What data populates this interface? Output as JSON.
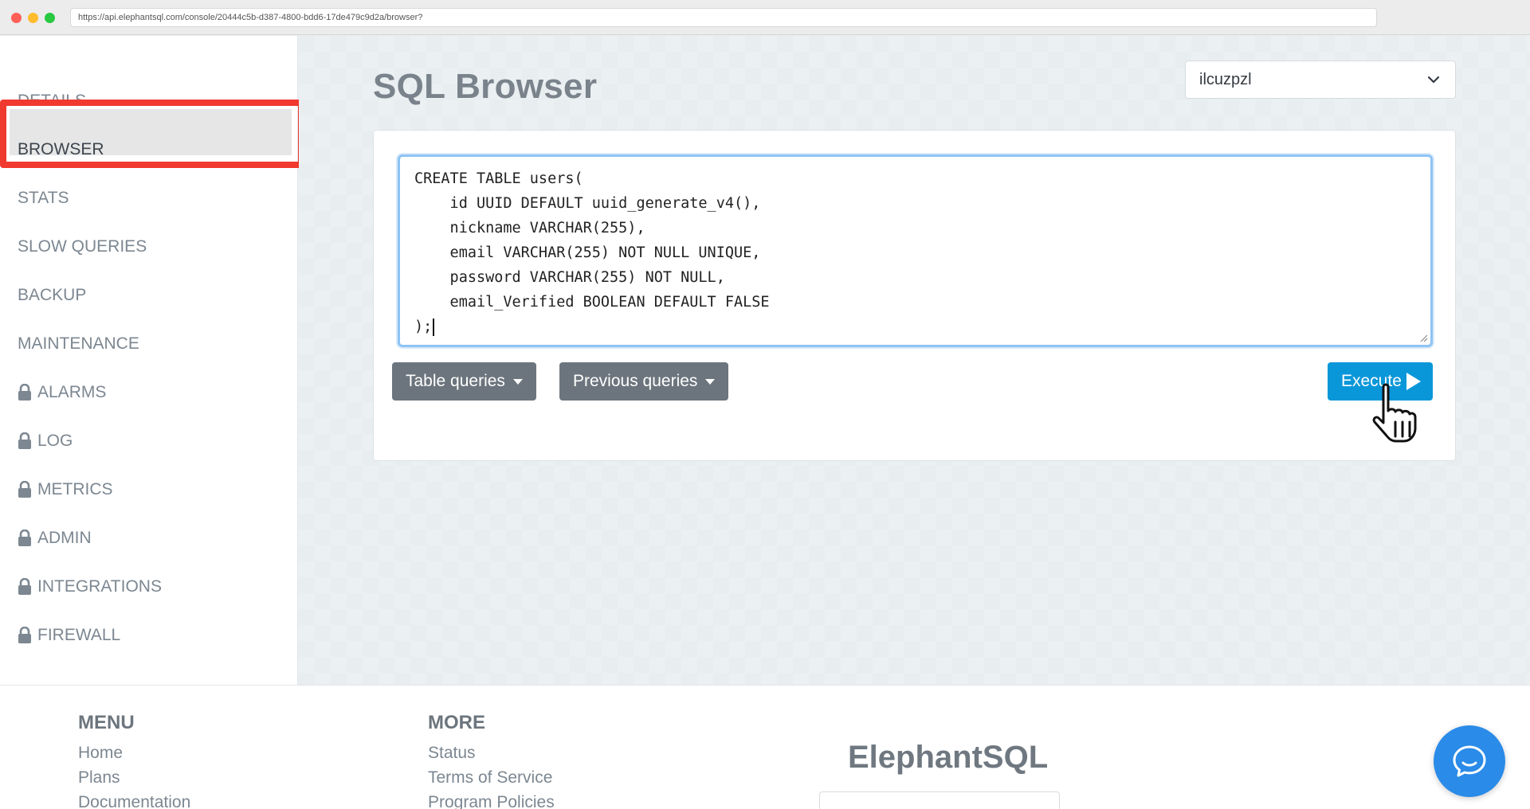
{
  "browser": {
    "url": "https://api.elephantsql.com/console/20444c5b-d387-4800-bdd6-17de479c9d2a/browser?"
  },
  "sidebar": {
    "items": [
      {
        "label": "DETAILS",
        "locked": false
      },
      {
        "label": "BROWSER",
        "locked": false,
        "active": true
      },
      {
        "label": "STATS",
        "locked": false
      },
      {
        "label": "SLOW QUERIES",
        "locked": false
      },
      {
        "label": "BACKUP",
        "locked": false
      },
      {
        "label": "MAINTENANCE",
        "locked": false
      },
      {
        "label": "ALARMS",
        "locked": true
      },
      {
        "label": "LOG",
        "locked": true
      },
      {
        "label": "METRICS",
        "locked": true
      },
      {
        "label": "ADMIN",
        "locked": true
      },
      {
        "label": "INTEGRATIONS",
        "locked": true
      },
      {
        "label": "FIREWALL",
        "locked": true
      }
    ]
  },
  "main": {
    "title": "SQL Browser",
    "database_select": {
      "value": "ilcuzpzl"
    },
    "editor": {
      "lines": [
        "CREATE TABLE users(",
        "    id UUID DEFAULT uuid_generate_v4(),",
        "    nickname VARCHAR(255),",
        "    email VARCHAR(255) NOT NULL UNIQUE,",
        "    password VARCHAR(255) NOT NULL,",
        "    email_Verified BOOLEAN DEFAULT FALSE",
        ");"
      ]
    },
    "table_queries_label": "Table queries",
    "previous_queries_label": "Previous queries",
    "execute_label": "Execute"
  },
  "footer": {
    "menu": {
      "heading": "MENU",
      "links": [
        "Home",
        "Plans",
        "Documentation"
      ]
    },
    "more": {
      "heading": "MORE",
      "links": [
        "Status",
        "Terms of Service",
        "Program Policies"
      ]
    },
    "brand": "ElephantSQL"
  },
  "colors": {
    "accent": "#0a97d9",
    "highlight": "#f0392f",
    "secondary_button": "#6c757d",
    "chat": "#2a8be8"
  }
}
